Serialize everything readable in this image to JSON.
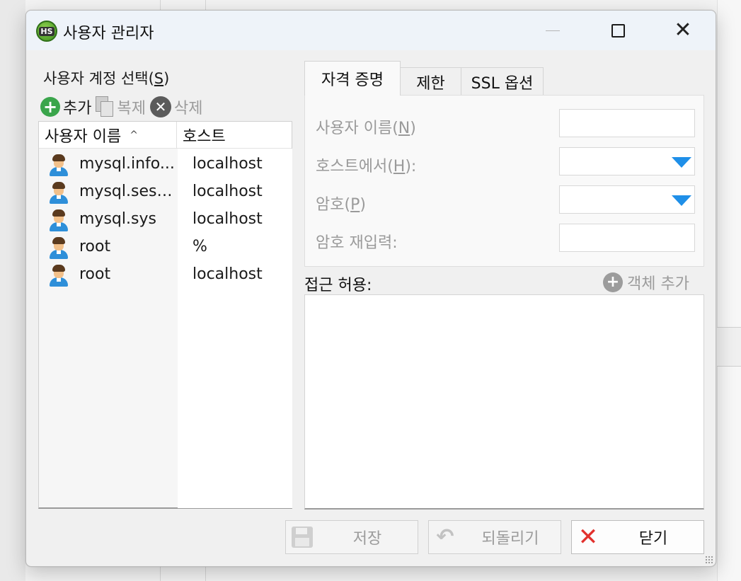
{
  "window": {
    "title": "사용자 관리자",
    "icon_text": "HS",
    "controls": {
      "minimize": "minimize-icon",
      "maximize": "maximize-icon",
      "close": "close-icon"
    }
  },
  "user_section": {
    "label": "사용자 계정 선택",
    "accelerator": "S",
    "toolbar": {
      "add": "추가",
      "clone": "복제",
      "delete": "삭제"
    },
    "columns": {
      "name": "사용자 이름",
      "host": "호스트"
    },
    "users": [
      {
        "name": "mysql.info...",
        "host": "localhost"
      },
      {
        "name": "mysql.sessi...",
        "host": "localhost"
      },
      {
        "name": "mysql.sys",
        "host": "localhost"
      },
      {
        "name": "root",
        "host": "%"
      },
      {
        "name": "root",
        "host": "localhost"
      }
    ]
  },
  "tabs": {
    "credentials": "자격 증명",
    "limits": "제한",
    "ssl": "SSL 옵션"
  },
  "credentials": {
    "username_label": "사용자 이름",
    "username_key": "N",
    "host_label": "호스트에서",
    "host_key": "H",
    "password_label": "암호",
    "password_key": "P",
    "confirm_label": "암호 재입력:"
  },
  "access": {
    "label": "접근 허용:",
    "add_object": "객체 추가"
  },
  "buttons": {
    "save": "저장",
    "revert": "되돌리기",
    "close": "닫기"
  },
  "colors": {
    "accent_blue": "#1f8fe8",
    "add_green": "#3aa54b",
    "close_red": "#e2312d"
  }
}
